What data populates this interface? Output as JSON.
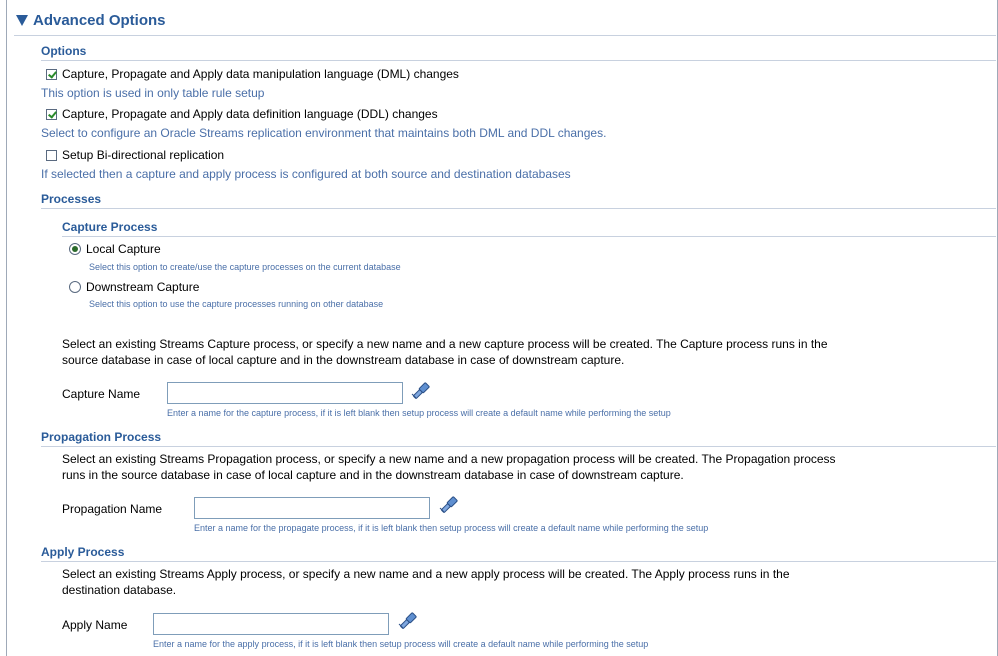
{
  "advanced": {
    "title": "Advanced Options"
  },
  "options": {
    "heading": "Options",
    "dml": {
      "label": "Capture, Propagate and Apply data manipulation language (DML) changes",
      "checked": true,
      "help": "This option is used in only table rule setup"
    },
    "ddl": {
      "label": "Capture, Propagate and Apply data definition language (DDL) changes",
      "checked": true,
      "help": "Select to configure an Oracle Streams replication environment that maintains both DML and DDL changes."
    },
    "bidir": {
      "label": "Setup Bi-directional replication",
      "checked": false,
      "help": "If selected then a capture and apply process is configured at both source and destination databases"
    }
  },
  "processes": {
    "heading": "Processes",
    "capture": {
      "heading": "Capture Process",
      "local": {
        "label": "Local Capture",
        "selected": true,
        "help": "Select this option to create/use the capture processes on the current database"
      },
      "downstream": {
        "label": "Downstream Capture",
        "selected": false,
        "help": "Select this option to use the capture processes running on other database"
      },
      "description_1": "Select an existing Streams Capture process, or specify a new name and a new capture process will be created. The Capture process runs in the",
      "description_2": "source database in case of local capture and in the downstream database in case of downstream capture.",
      "name_label": "Capture Name",
      "name_value": "",
      "name_hint": "Enter a name for the capture process, if it is left blank then setup process will create a default name while performing the setup"
    },
    "propagation": {
      "heading": "Propagation Process",
      "description_1": "Select an existing Streams Propagation process, or specify a new name and a new propagation process will be created. The Propagation process",
      "description_2": "runs in the source database in case of local capture and in the downstream database in case of downstream capture.",
      "name_label": "Propagation Name",
      "name_value": "",
      "name_hint": "Enter a name for the propagate process, if it is left blank then setup process will create a default name while performing the setup"
    },
    "apply": {
      "heading": "Apply Process",
      "description_1": "Select an existing Streams Apply process, or specify a new name and a new apply process will be created. The Apply process runs in the",
      "description_2": "destination database.",
      "name_label": "Apply Name",
      "name_value": "",
      "name_hint": "Enter a name for the apply process, if it is left blank then setup process will create a default name while performing the setup"
    }
  },
  "icons": {
    "expand": "triangle-down-icon",
    "search": "flashlight-icon"
  },
  "colors": {
    "heading": "#2a5b99",
    "help_text": "#4a6fa8",
    "check": "#2b8a2b"
  }
}
